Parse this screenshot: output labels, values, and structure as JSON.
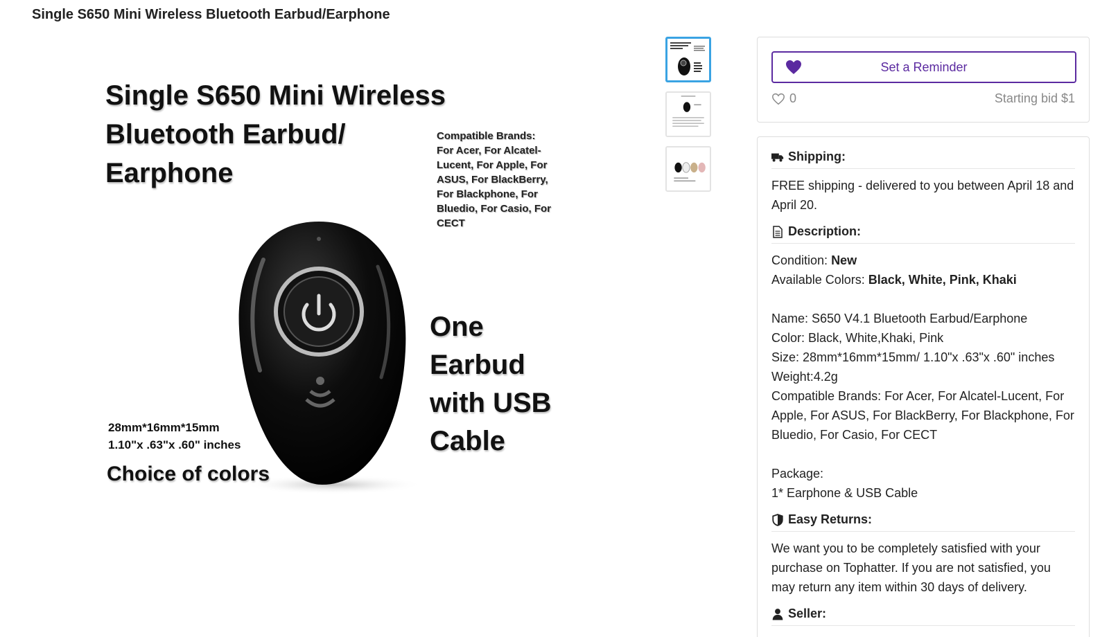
{
  "page": {
    "title": "Single S650 Mini Wireless Bluetooth Earbud/Earphone"
  },
  "hero": {
    "title": "Single S650 Mini Wireless\nBluetooth Earbud/\nEarphone",
    "brands": "Compatible Brands: For Acer, For Alcatel-Lucent, For Apple, For ASUS, For BlackBerry, For Blackphone, For Bluedio, For Casio, For CECT",
    "one_earbud": "One\nEarbud\nwith USB\nCable",
    "size": "28mm*16mm*15mm\n1.10\"x .63\"x .60\" inches",
    "colors": "Choice of colors"
  },
  "thumbnails": [
    {
      "name": "thumb-1",
      "active": true
    },
    {
      "name": "thumb-2",
      "active": false
    },
    {
      "name": "thumb-3",
      "active": false
    }
  ],
  "reminder": {
    "button_label": "Set a Reminder",
    "likes": "0",
    "starting_bid": "Starting bid $1"
  },
  "shipping": {
    "heading": "Shipping:",
    "text": "FREE shipping - delivered to you between April 18 and April 20."
  },
  "description": {
    "heading": "Description:",
    "condition_label": "Condition: ",
    "condition_value": "New",
    "colors_label": "Available Colors: ",
    "colors_value": "Black, White, Pink, Khaki",
    "name": "Name: S650 V4.1 Bluetooth Earbud/Earphone",
    "color": "Color: Black, White,Khaki, Pink",
    "size": "Size: 28mm*16mm*15mm/ 1.10\"x .63\"x .60\" inches",
    "weight": "Weight:4.2g",
    "brands": "Compatible Brands: For Acer, For Alcatel-Lucent, For Apple, For ASUS, For BlackBerry, For Blackphone, For Bluedio, For Casio, For CECT",
    "package_label": "Package:",
    "package_value": "1* Earphone & USB Cable"
  },
  "returns": {
    "heading": "Easy Returns:",
    "text": "We want you to be completely satisfied with your purchase on Tophatter. If you are not satisfied, you may return any item within 30 days of delivery."
  },
  "seller": {
    "heading": "Seller:"
  },
  "colors": {
    "accent": "#5b2aa0",
    "thumb_active": "#3aa3e3",
    "muted": "#888888"
  }
}
